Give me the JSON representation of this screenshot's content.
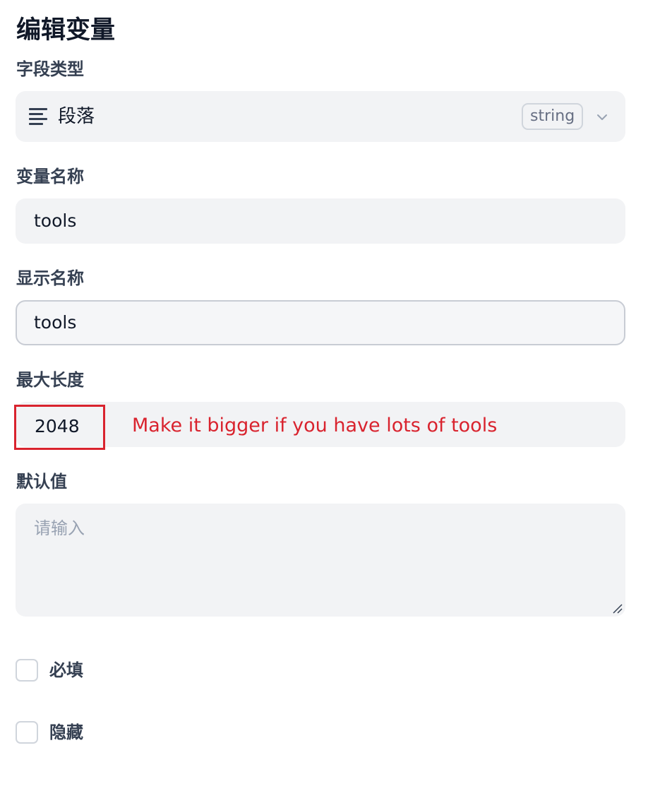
{
  "dialog": {
    "title": "编辑变量"
  },
  "field_type": {
    "label": "字段类型",
    "selected": "段落",
    "badge": "string",
    "icon": "paragraph-lines-icon"
  },
  "variable_name": {
    "label": "变量名称",
    "value": "tools"
  },
  "display_name": {
    "label": "显示名称",
    "value": "tools"
  },
  "max_length": {
    "label": "最大长度",
    "value": "2048",
    "annotation": "Make it bigger if you have lots of tools"
  },
  "default_value": {
    "label": "默认值",
    "placeholder": "请输入"
  },
  "required": {
    "label": "必填",
    "checked": false
  },
  "hidden": {
    "label": "隐藏",
    "checked": false
  },
  "colors": {
    "annotation": "#d9232e",
    "field_bg": "#f2f3f5",
    "label": "#354052"
  }
}
